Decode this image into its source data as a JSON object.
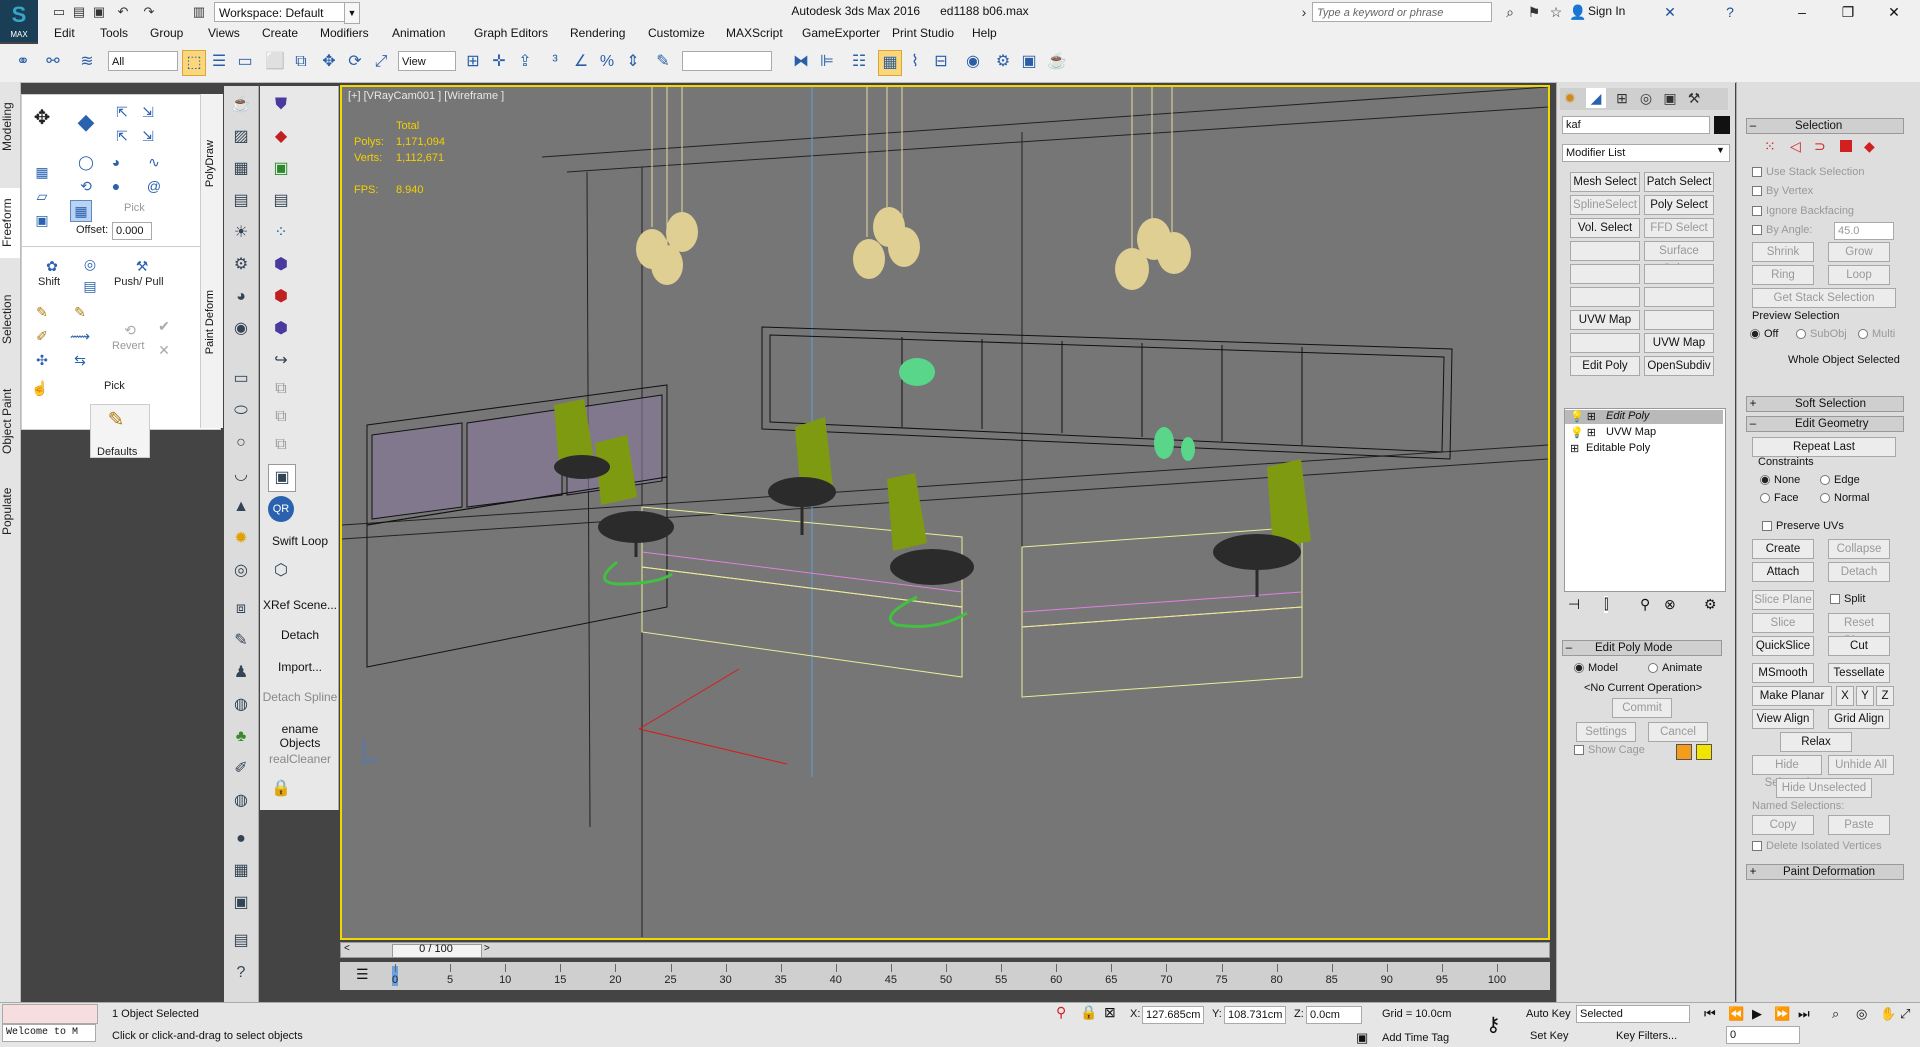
{
  "app": {
    "logo_label": "MAX",
    "window_title": "Autodesk 3ds Max 2016",
    "file_name": "ed1188 b06.max",
    "workspace": "Workspace: Default",
    "search_placeholder": "Type a keyword or phrase",
    "sign_in": "Sign In"
  },
  "menu": [
    "Edit",
    "Tools",
    "Group",
    "Views",
    "Create",
    "Modifiers",
    "Animation",
    "Graph Editors",
    "Rendering",
    "Customize",
    "MAXScript",
    "GameExporter",
    "Print Studio",
    "Help"
  ],
  "toolbar": {
    "selection_filter": "All",
    "ref_coord": "View",
    "named_selection": ""
  },
  "left_tabs": [
    "Modeling",
    "Freeform",
    "Selection",
    "Object Paint",
    "Populate"
  ],
  "ribbon": {
    "polydraw": "PolyDraw",
    "paint_deform": "Paint Deform",
    "pick": "Pick",
    "offset_label": "Offset:",
    "offset_value": "0.000",
    "shift": "Shift",
    "push_pull": "Push/ Pull",
    "revert": "Revert",
    "pick2": "Pick",
    "defaults": "Defaults"
  },
  "col2_labels": {
    "swift_loop": "Swift Loop",
    "xref": "XRef Scene...",
    "detach": "Detach",
    "import": "Import...",
    "detach_spline": "Detach Spline",
    "rename": "ename Objects",
    "cleaner": "realCleaner"
  },
  "viewport": {
    "label": "[+] [VRayCam001 ] [Wireframe ]",
    "total": "Total",
    "polys_label": "Polys:",
    "polys": "1,171,094",
    "verts_label": "Verts:",
    "verts": "1,112,671",
    "fps_label": "FPS:",
    "fps": "8.940"
  },
  "timeline": {
    "frame": "0 / 100",
    "ticks": [
      "0",
      "5",
      "10",
      "15",
      "20",
      "25",
      "30",
      "35",
      "40",
      "45",
      "50",
      "55",
      "60",
      "65",
      "70",
      "75",
      "80",
      "85",
      "90",
      "95",
      "100"
    ]
  },
  "cmdpanel": {
    "object_name": "kaf",
    "modifier_list": "Modifier List",
    "buttons": [
      [
        "Mesh Select",
        "Patch Select"
      ],
      [
        "SplineSelect",
        "Poly Select"
      ],
      [
        "Vol. Select",
        "FFD Select"
      ],
      [
        "",
        "Surface Select"
      ],
      [
        "",
        ""
      ],
      [
        "",
        ""
      ],
      [
        "UVW Map",
        ""
      ],
      [
        "",
        "UVW Map"
      ],
      [
        "Edit Poly",
        "OpenSubdiv"
      ]
    ],
    "stack": [
      "Edit Poly",
      "UVW Map",
      "Editable Poly"
    ],
    "edit_poly_mode": "Edit Poly Mode",
    "model": "Model",
    "animate": "Animate",
    "no_op": "<No Current Operation>",
    "commit": "Commit",
    "settings": "Settings",
    "cancel": "Cancel",
    "show_cage": "Show Cage"
  },
  "modpanel": {
    "selection": "Selection",
    "use_stack": "Use Stack Selection",
    "by_vertex": "By Vertex",
    "ignore_backfacing": "Ignore Backfacing",
    "by_angle": "By Angle:",
    "by_angle_val": "45.0",
    "shrink": "Shrink",
    "grow": "Grow",
    "ring": "Ring",
    "loop": "Loop",
    "get_stack": "Get Stack Selection",
    "preview_selection": "Preview Selection",
    "off": "Off",
    "subobj": "SubObj",
    "multi": "Multi",
    "whole_object": "Whole Object Selected",
    "soft_selection": "Soft Selection",
    "edit_geometry": "Edit Geometry",
    "repeat_last": "Repeat Last",
    "constraints": "Constraints",
    "none": "None",
    "edge": "Edge",
    "face": "Face",
    "normal": "Normal",
    "preserve_uvs": "Preserve UVs",
    "create": "Create",
    "collapse": "Collapse",
    "attach": "Attach",
    "detach": "Detach",
    "slice_plane": "Slice Plane",
    "split": "Split",
    "slice": "Slice",
    "reset_plane": "Reset Plane",
    "quickslice": "QuickSlice",
    "cut": "Cut",
    "msmooth": "MSmooth",
    "tessellate": "Tessellate",
    "make_planar": "Make Planar",
    "x": "X",
    "y": "Y",
    "z": "Z",
    "view_align": "View Align",
    "grid_align": "Grid Align",
    "relax": "Relax",
    "hide_selected": "Hide Selected",
    "unhide_all": "Unhide All",
    "hide_unselected": "Hide Unselected",
    "named_selections": "Named Selections:",
    "copy": "Copy",
    "paste": "Paste",
    "delete_isolated": "Delete Isolated Vertices",
    "paint_deformation": "Paint Deformation"
  },
  "status": {
    "welcome": "Welcome to M",
    "selected": "1 Object Selected",
    "prompt": "Click or click-and-drag to select objects",
    "x_label": "X:",
    "x": "127.685cm",
    "y_label": "Y:",
    "y": "108.731cm",
    "z_label": "Z:",
    "z": "0.0cm",
    "grid": "Grid = 10.0cm",
    "add_time_tag": "Add Time Tag",
    "auto_key": "Auto Key",
    "set_key": "Set Key",
    "key_mode": "Selected",
    "key_filters": "Key Filters...",
    "frame_field": "0"
  },
  "colors": {
    "viewport_bg": "#767676",
    "active_border": "#f1d800",
    "stats": "#f3d000",
    "chair_green": "#7e9a10"
  }
}
